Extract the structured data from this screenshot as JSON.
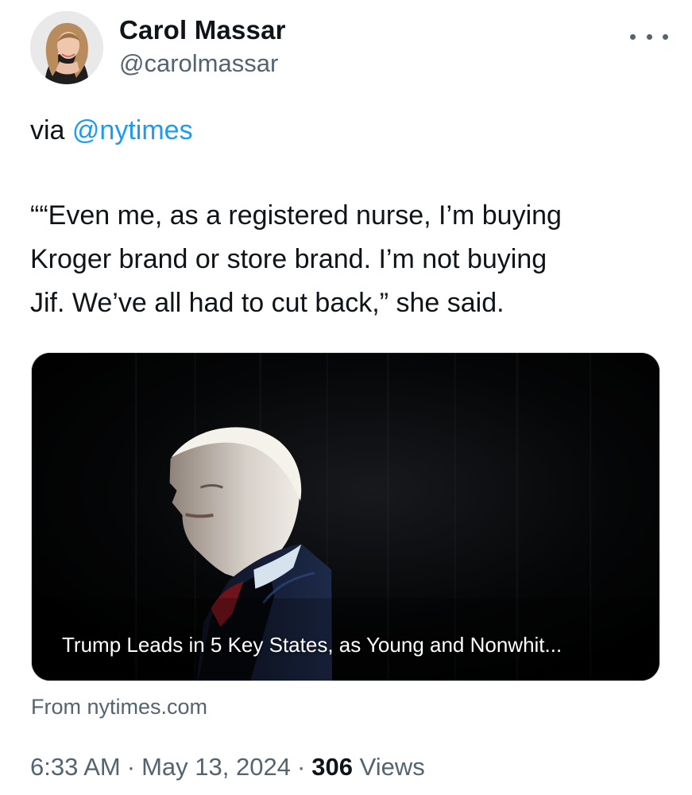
{
  "profile": {
    "display_name": "Carol Massar",
    "handle": "@carolmassar"
  },
  "tweet": {
    "via_prefix": "via ",
    "mention": "@nytimes",
    "quote": "““Even me, as a registered nurse, I’m buying\nKroger brand or store brand. I’m not buying\nJif. We’ve all had to cut back,” she said."
  },
  "card": {
    "title": "Trump Leads in 5 Key States, as Young and Nonwhit...",
    "source": "From nytimes.com"
  },
  "meta": {
    "time": "6:33 AM",
    "date": "May 13, 2024",
    "views_count": "306",
    "views_label": " Views",
    "separator": "·"
  },
  "icons": {
    "more": "more-options-icon"
  },
  "colors": {
    "text": "#0f1419",
    "muted": "#536471",
    "link": "#1d9bf0",
    "card_border": "#cfd9de"
  }
}
